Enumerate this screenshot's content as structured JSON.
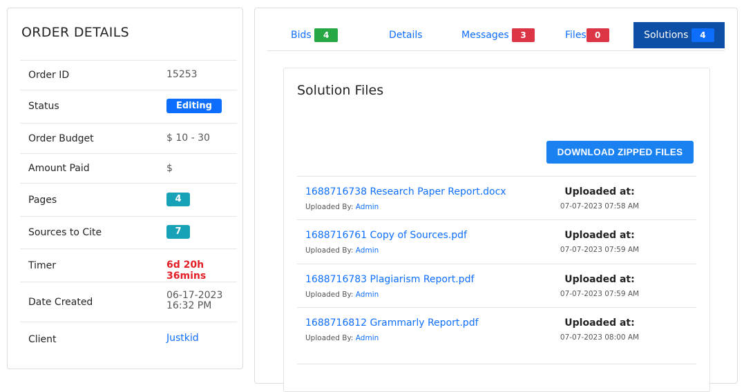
{
  "order": {
    "title": "ORDER DETAILS",
    "rows": [
      {
        "label": "Order ID",
        "value": "15253"
      },
      {
        "label": "Status",
        "value": "Editing"
      },
      {
        "label": "Order Budget",
        "value": "$ 10 - 30"
      },
      {
        "label": "Amount Paid",
        "value": "$"
      },
      {
        "label": "Pages",
        "value": "4"
      },
      {
        "label": "Sources to Cite",
        "value": "7"
      },
      {
        "label": "Timer",
        "value": "6d 20h 36mins"
      },
      {
        "label": "Date Created",
        "value_line1": "06-17-2023",
        "value_line2": "16:32 PM"
      },
      {
        "label": "Client",
        "value": "Justkid"
      }
    ]
  },
  "tabs": [
    {
      "label": "Bids",
      "count": "4"
    },
    {
      "label": "Details"
    },
    {
      "label": "Messages",
      "count": "3"
    },
    {
      "label": "Files",
      "count": "0"
    },
    {
      "label": "Solutions",
      "count": "4",
      "active": true
    }
  ],
  "solutions": {
    "title": "Solution Files",
    "download_label": "DOWNLOAD ZIPPED FILES",
    "uploaded_by_label": "Uploaded By:",
    "uploaded_at_label": "Uploaded at:",
    "files": [
      {
        "name": "1688716738 Research Paper Report.docx",
        "uploader": "Admin",
        "date": "07-07-2023 07:58 AM"
      },
      {
        "name": "1688716761 Copy of Sources.pdf",
        "uploader": "Admin",
        "date": "07-07-2023 07:59 AM"
      },
      {
        "name": "1688716783 Plagiarism Report.pdf",
        "uploader": "Admin",
        "date": "07-07-2023 07:59 AM"
      },
      {
        "name": "1688716812 Grammarly Report.pdf",
        "uploader": "Admin",
        "date": "07-07-2023 08:00 AM"
      }
    ]
  },
  "colors": {
    "primary": "#0d6efd",
    "success": "#28a745",
    "danger": "#dc3545",
    "info": "#17a2b8",
    "active_tab": "#0d4ea6",
    "timer": "#e41e26"
  }
}
